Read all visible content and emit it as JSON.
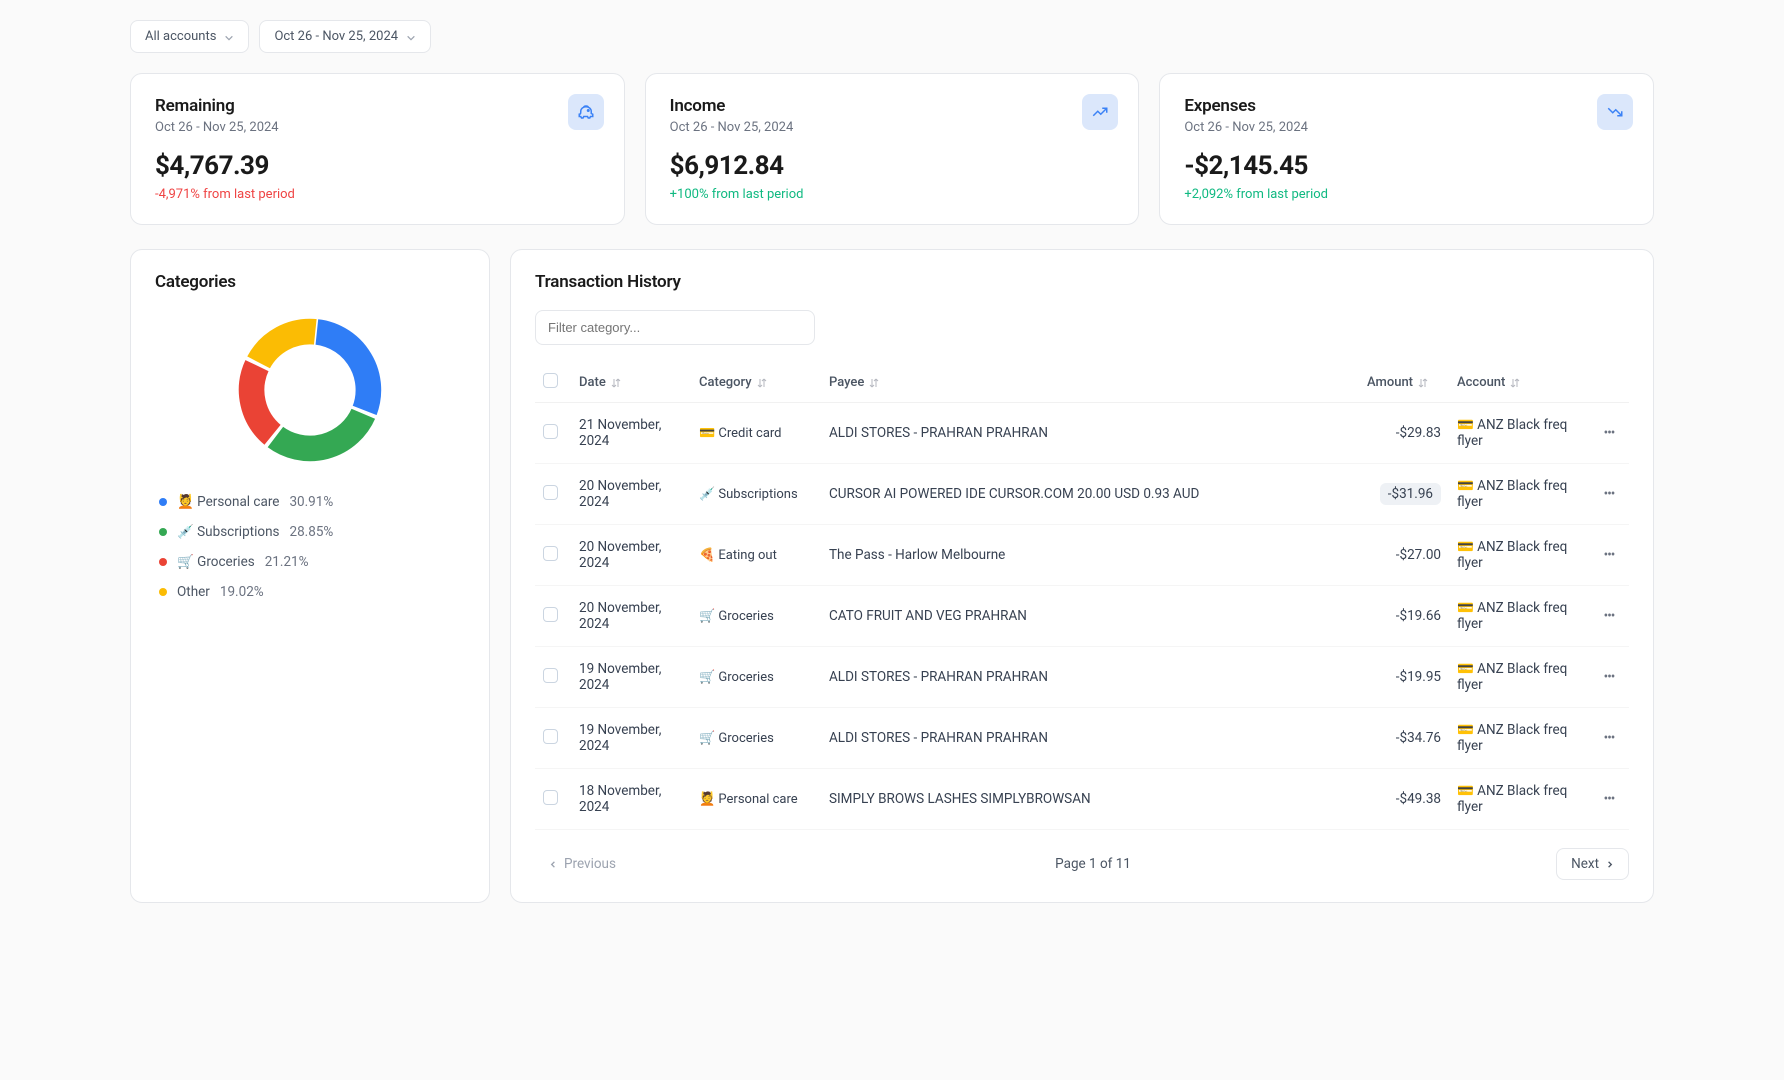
{
  "filters": {
    "account": "All accounts",
    "period": "Oct 26 - Nov 25, 2024"
  },
  "cards": {
    "remaining": {
      "title": "Remaining",
      "sub": "Oct 26 - Nov 25, 2024",
      "value": "$4,767.39",
      "delta": "-4,971% from last period",
      "delta_positive": false
    },
    "income": {
      "title": "Income",
      "sub": "Oct 26 - Nov 25, 2024",
      "value": "$6,912.84",
      "delta": "+100% from last period",
      "delta_positive": true
    },
    "expenses": {
      "title": "Expenses",
      "sub": "Oct 26 - Nov 25, 2024",
      "value": "-$2,145.45",
      "delta": "+2,092% from last period",
      "delta_positive": true
    }
  },
  "categories": {
    "title": "Categories",
    "items": [
      {
        "label": "💆 Personal care",
        "pct": "30.91%",
        "color": "#2f7df6"
      },
      {
        "label": "💉 Subscriptions",
        "pct": "28.85%",
        "color": "#34a853"
      },
      {
        "label": "🛒 Groceries",
        "pct": "21.21%",
        "color": "#ea4335"
      },
      {
        "label": "Other",
        "pct": "19.02%",
        "color": "#fbbc04"
      }
    ]
  },
  "chart_data": {
    "type": "pie",
    "title": "Categories",
    "series": [
      {
        "name": "Personal care",
        "value": 30.91,
        "color": "#2f7df6"
      },
      {
        "name": "Subscriptions",
        "value": 28.85,
        "color": "#34a853"
      },
      {
        "name": "Groceries",
        "value": 21.21,
        "color": "#ea4335"
      },
      {
        "name": "Other",
        "value": 19.02,
        "color": "#fbbc04"
      }
    ]
  },
  "history": {
    "title": "Transaction History",
    "filter_placeholder": "Filter category...",
    "columns": {
      "date": "Date",
      "category": "Category",
      "payee": "Payee",
      "amount": "Amount",
      "account": "Account"
    },
    "rows": [
      {
        "date": "21 November, 2024",
        "category": "💳 Credit card",
        "payee": "ALDI STORES - PRAHRAN PRAHRAN",
        "amount": "-$29.83",
        "account": "💳 ANZ Black freq flyer",
        "hl": false
      },
      {
        "date": "20 November, 2024",
        "category": "💉 Subscriptions",
        "payee": "CURSOR AI POWERED IDE CURSOR.COM 20.00 USD 0.93 AUD",
        "amount": "-$31.96",
        "account": "💳 ANZ Black freq flyer",
        "hl": true
      },
      {
        "date": "20 November, 2024",
        "category": "🍕 Eating out",
        "payee": "The Pass - Harlow Melbourne",
        "amount": "-$27.00",
        "account": "💳 ANZ Black freq flyer",
        "hl": false
      },
      {
        "date": "20 November, 2024",
        "category": "🛒 Groceries",
        "payee": "CATO FRUIT AND VEG PRAHRAN",
        "amount": "-$19.66",
        "account": "💳 ANZ Black freq flyer",
        "hl": false
      },
      {
        "date": "19 November, 2024",
        "category": "🛒 Groceries",
        "payee": "ALDI STORES - PRAHRAN PRAHRAN",
        "amount": "-$19.95",
        "account": "💳 ANZ Black freq flyer",
        "hl": false
      },
      {
        "date": "19 November, 2024",
        "category": "🛒 Groceries",
        "payee": "ALDI STORES - PRAHRAN PRAHRAN",
        "amount": "-$34.76",
        "account": "💳 ANZ Black freq flyer",
        "hl": false
      },
      {
        "date": "18 November, 2024",
        "category": "💆 Personal care",
        "payee": "SIMPLY BROWS LASHES SIMPLYBROWSAN",
        "amount": "-$49.38",
        "account": "💳 ANZ Black freq flyer",
        "hl": false
      }
    ],
    "pager": {
      "prev": "Previous",
      "status": "Page 1 of 11",
      "next": "Next"
    }
  }
}
